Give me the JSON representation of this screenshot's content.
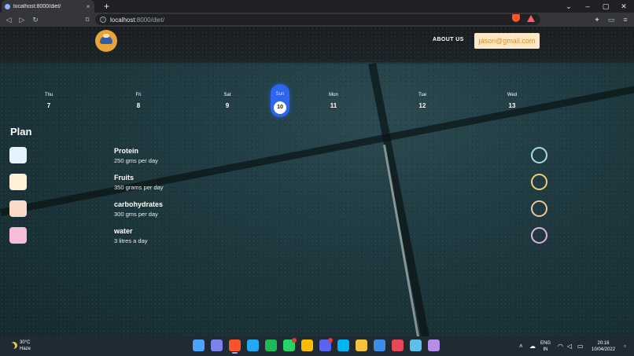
{
  "browser": {
    "tab_title": "localhost:8000/diet/",
    "new_tab": "+",
    "close_tab": "×",
    "url_host": "localhost",
    "url_path": ":8000/diet/"
  },
  "nav": {
    "about_label": "ABOUT US",
    "user_email": "jason@gmail.com"
  },
  "calendar": {
    "days": [
      {
        "name": "Thu",
        "date": "7"
      },
      {
        "name": "Fri",
        "date": "8"
      },
      {
        "name": "Sat",
        "date": "9"
      },
      {
        "name": "Sun",
        "date": "10"
      },
      {
        "name": "Mon",
        "date": "11"
      },
      {
        "name": "Tue",
        "date": "12"
      },
      {
        "name": "Wed",
        "date": "13"
      }
    ],
    "selected_index": 3,
    "selected_color": "#2a66f0"
  },
  "plan": {
    "title": "Plan",
    "items": [
      {
        "name": "Protein",
        "quantity": "250 gms per day",
        "swatch": "#e3f2fc",
        "ring": "#a8dcd9"
      },
      {
        "name": "Fruits",
        "quantity": "350 grams per day",
        "swatch": "#fdf0d8",
        "ring": "#e6cf8a"
      },
      {
        "name": "carbohydrates",
        "quantity": "300 gms per day",
        "swatch": "#fbd9c9",
        "ring": "#e3caa0"
      },
      {
        "name": "water",
        "quantity": "3 litres a day",
        "swatch": "#f7bcd8",
        "ring": "#d8b5e0"
      }
    ]
  },
  "taskbar": {
    "temperature": "30°C",
    "condition": "Haze",
    "language": "ENG",
    "region": "IN",
    "time": "20:16",
    "date": "10/04/2022",
    "apps": [
      {
        "name": "windows-start-icon",
        "color": "#4aa3ff"
      },
      {
        "name": "chat-icon",
        "color": "#7b83eb"
      },
      {
        "name": "brave-browser-icon",
        "color": "#fb542b",
        "active": true
      },
      {
        "name": "vscode-icon",
        "color": "#23a9f2"
      },
      {
        "name": "spotify-icon",
        "color": "#1db954"
      },
      {
        "name": "whatsapp-icon",
        "color": "#25d366",
        "badge": true
      },
      {
        "name": "chrome-icon",
        "color": "#fbbc04"
      },
      {
        "name": "discord-icon",
        "color": "#5865f2",
        "badge": true
      },
      {
        "name": "cortana-icon",
        "color": "#00b4f0"
      },
      {
        "name": "file-explorer-icon",
        "color": "#f3c23c"
      },
      {
        "name": "photos-icon",
        "color": "#3a8ee6"
      },
      {
        "name": "store-icon",
        "color": "#e74856"
      },
      {
        "name": "notepad-icon",
        "color": "#5bc0eb"
      },
      {
        "name": "github-icon",
        "color": "#b48ee8"
      }
    ]
  }
}
